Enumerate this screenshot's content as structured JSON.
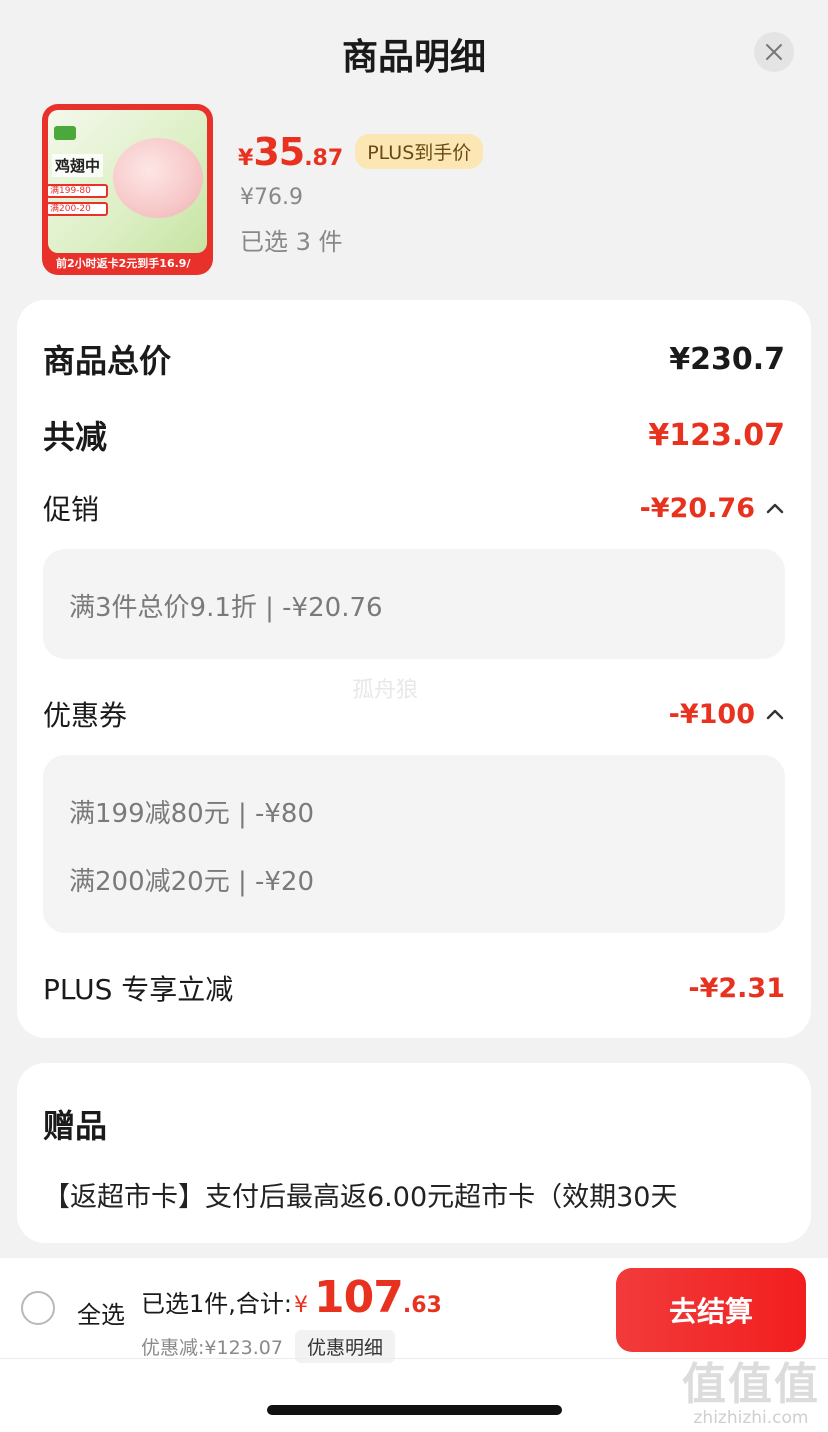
{
  "header": {
    "title": "商品明细"
  },
  "product": {
    "image_text": {
      "name": "鸡翅中",
      "tag1": "满199-80",
      "tag2": "满200-20",
      "banner": "前2小时返卡2元到手16.9/"
    },
    "price_symbol": "¥",
    "price_int": "35",
    "price_dec": ".87",
    "plus_badge": "PLUS到手价",
    "original_price": "¥76.9",
    "selected": "已选 3 件"
  },
  "summary": {
    "total_label": "商品总价",
    "total_value": "¥230.7",
    "reduce_label": "共减",
    "reduce_value": "¥123.07",
    "promo_label": "促销",
    "promo_value": "-¥20.76",
    "promo_detail": "满3件总价9.1折 | -¥20.76",
    "coupon_label": "优惠券",
    "coupon_value": "-¥100",
    "coupon_details": [
      "满199减80元 | -¥80",
      "满200减20元 | -¥20"
    ],
    "plus_label": "PLUS 专享立减",
    "plus_value": "-¥2.31"
  },
  "watermark": "孤舟狼",
  "gift": {
    "title": "赠品",
    "text": "【返超市卡】支付后最高返6.00元超市卡（效期30天"
  },
  "bottom": {
    "select_all": "全选",
    "total_label": "已选1件,合计:",
    "total_yen": "¥",
    "total_int": "107",
    "total_dec": ".63",
    "discount_text": "优惠减:¥123.07",
    "discount_detail_btn": "优惠明细",
    "checkout": "去结算"
  },
  "corner_logo": {
    "big": "值值值",
    "small": "zhizhizhi.com"
  },
  "colors": {
    "accent_red": "#e8321f",
    "plus_gold": "#fbe6b4"
  }
}
